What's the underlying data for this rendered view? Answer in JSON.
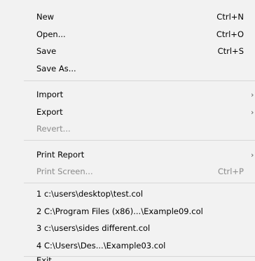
{
  "menu": {
    "new": {
      "label": "New",
      "shortcut": "Ctrl+N"
    },
    "open": {
      "label": "Open...",
      "shortcut": "Ctrl+O"
    },
    "save": {
      "label": "Save",
      "shortcut": "Ctrl+S"
    },
    "save_as": {
      "label": "Save As..."
    },
    "import": {
      "label": "Import",
      "submenu": true
    },
    "export": {
      "label": "Export",
      "submenu": true
    },
    "revert": {
      "label": "Revert...",
      "disabled": true
    },
    "print_report": {
      "label": "Print Report",
      "submenu": true
    },
    "print_screen": {
      "label": "Print Screen...",
      "shortcut": "Ctrl+P",
      "disabled": true
    },
    "recent_files": [
      {
        "label": "1 c:\\users\\desktop\\test.col"
      },
      {
        "label": "2 C:\\Program Files (x86)...\\Example09.col"
      },
      {
        "label": "3 c:\\users\\sides different.col"
      },
      {
        "label": "4 C:\\Users\\Des...\\Example03.col"
      }
    ],
    "exit": {
      "label": "Exit"
    },
    "submenu_arrow": "›"
  }
}
